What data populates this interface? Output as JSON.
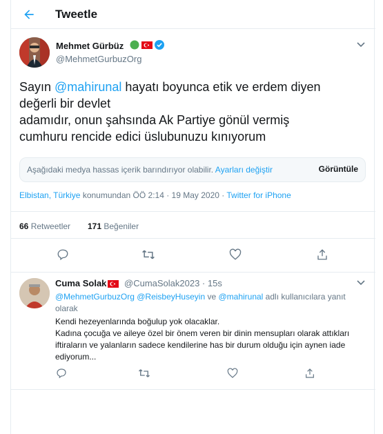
{
  "header": {
    "title": "Tweetle",
    "back_icon": "arrow-left-icon"
  },
  "tweet": {
    "author_name": "Mehmet Gürbüz",
    "author_handle": "@MehmetGurbuzOrg",
    "text_prefix": "Sayın ",
    "mention": "@mahirunal",
    "text_line1_rest": " hayatı boyunca etik ve erdem diyen",
    "text_line2": "değerli bir devlet",
    "text_line3": "adamıdır, onun şahsında Ak Partiye gönül vermiş",
    "text_line4": "cumhuru rencide edici üslubunuzu kınıyorum",
    "sensitive_notice": "Aşağıdaki medya hassas içerik barındırıyor olabilir. ",
    "sensitive_settings_link": "Ayarları değiştir",
    "sensitive_view_button": "Görüntüle",
    "location_link": "Elbistan, Türkiye",
    "meta_middle": " konumundan ÖÖ 2:14 · 19 May 2020 · ",
    "source_link": "Twitter for iPhone",
    "retweets_count": "66",
    "retweets_label": " Retweetler",
    "likes_count": "171",
    "likes_label": " Beğeniler"
  },
  "reply": {
    "author_name": "Cuma Solak",
    "author_handle_time": "@CumaSolak2023 · 15s",
    "mention1": "@MehmetGurbuzOrg",
    "mention2": "@ReisbeyHuseyin",
    "mention_joiner": " ve ",
    "mention3": "@mahirunal",
    "reply_suffix": " adlı kullanıcılara yanıt olarak",
    "body_line1": "Kendi hezeyenlarında boğulup yok olacaklar.",
    "body_line2": "Kadına çocuğa ve aileye özel bir önem veren bir dinin mensupları olarak attıkları iftiraların ve yalanların sadece kendilerine has bir durum olduğu için aynen iade ediyorum..."
  },
  "colors": {
    "accent": "#1da1f2",
    "verified": "#1da1f2",
    "green_dot": "#4caf50",
    "flag_red": "#e30a17",
    "muted": "#657786",
    "border": "#e6ecf0"
  }
}
